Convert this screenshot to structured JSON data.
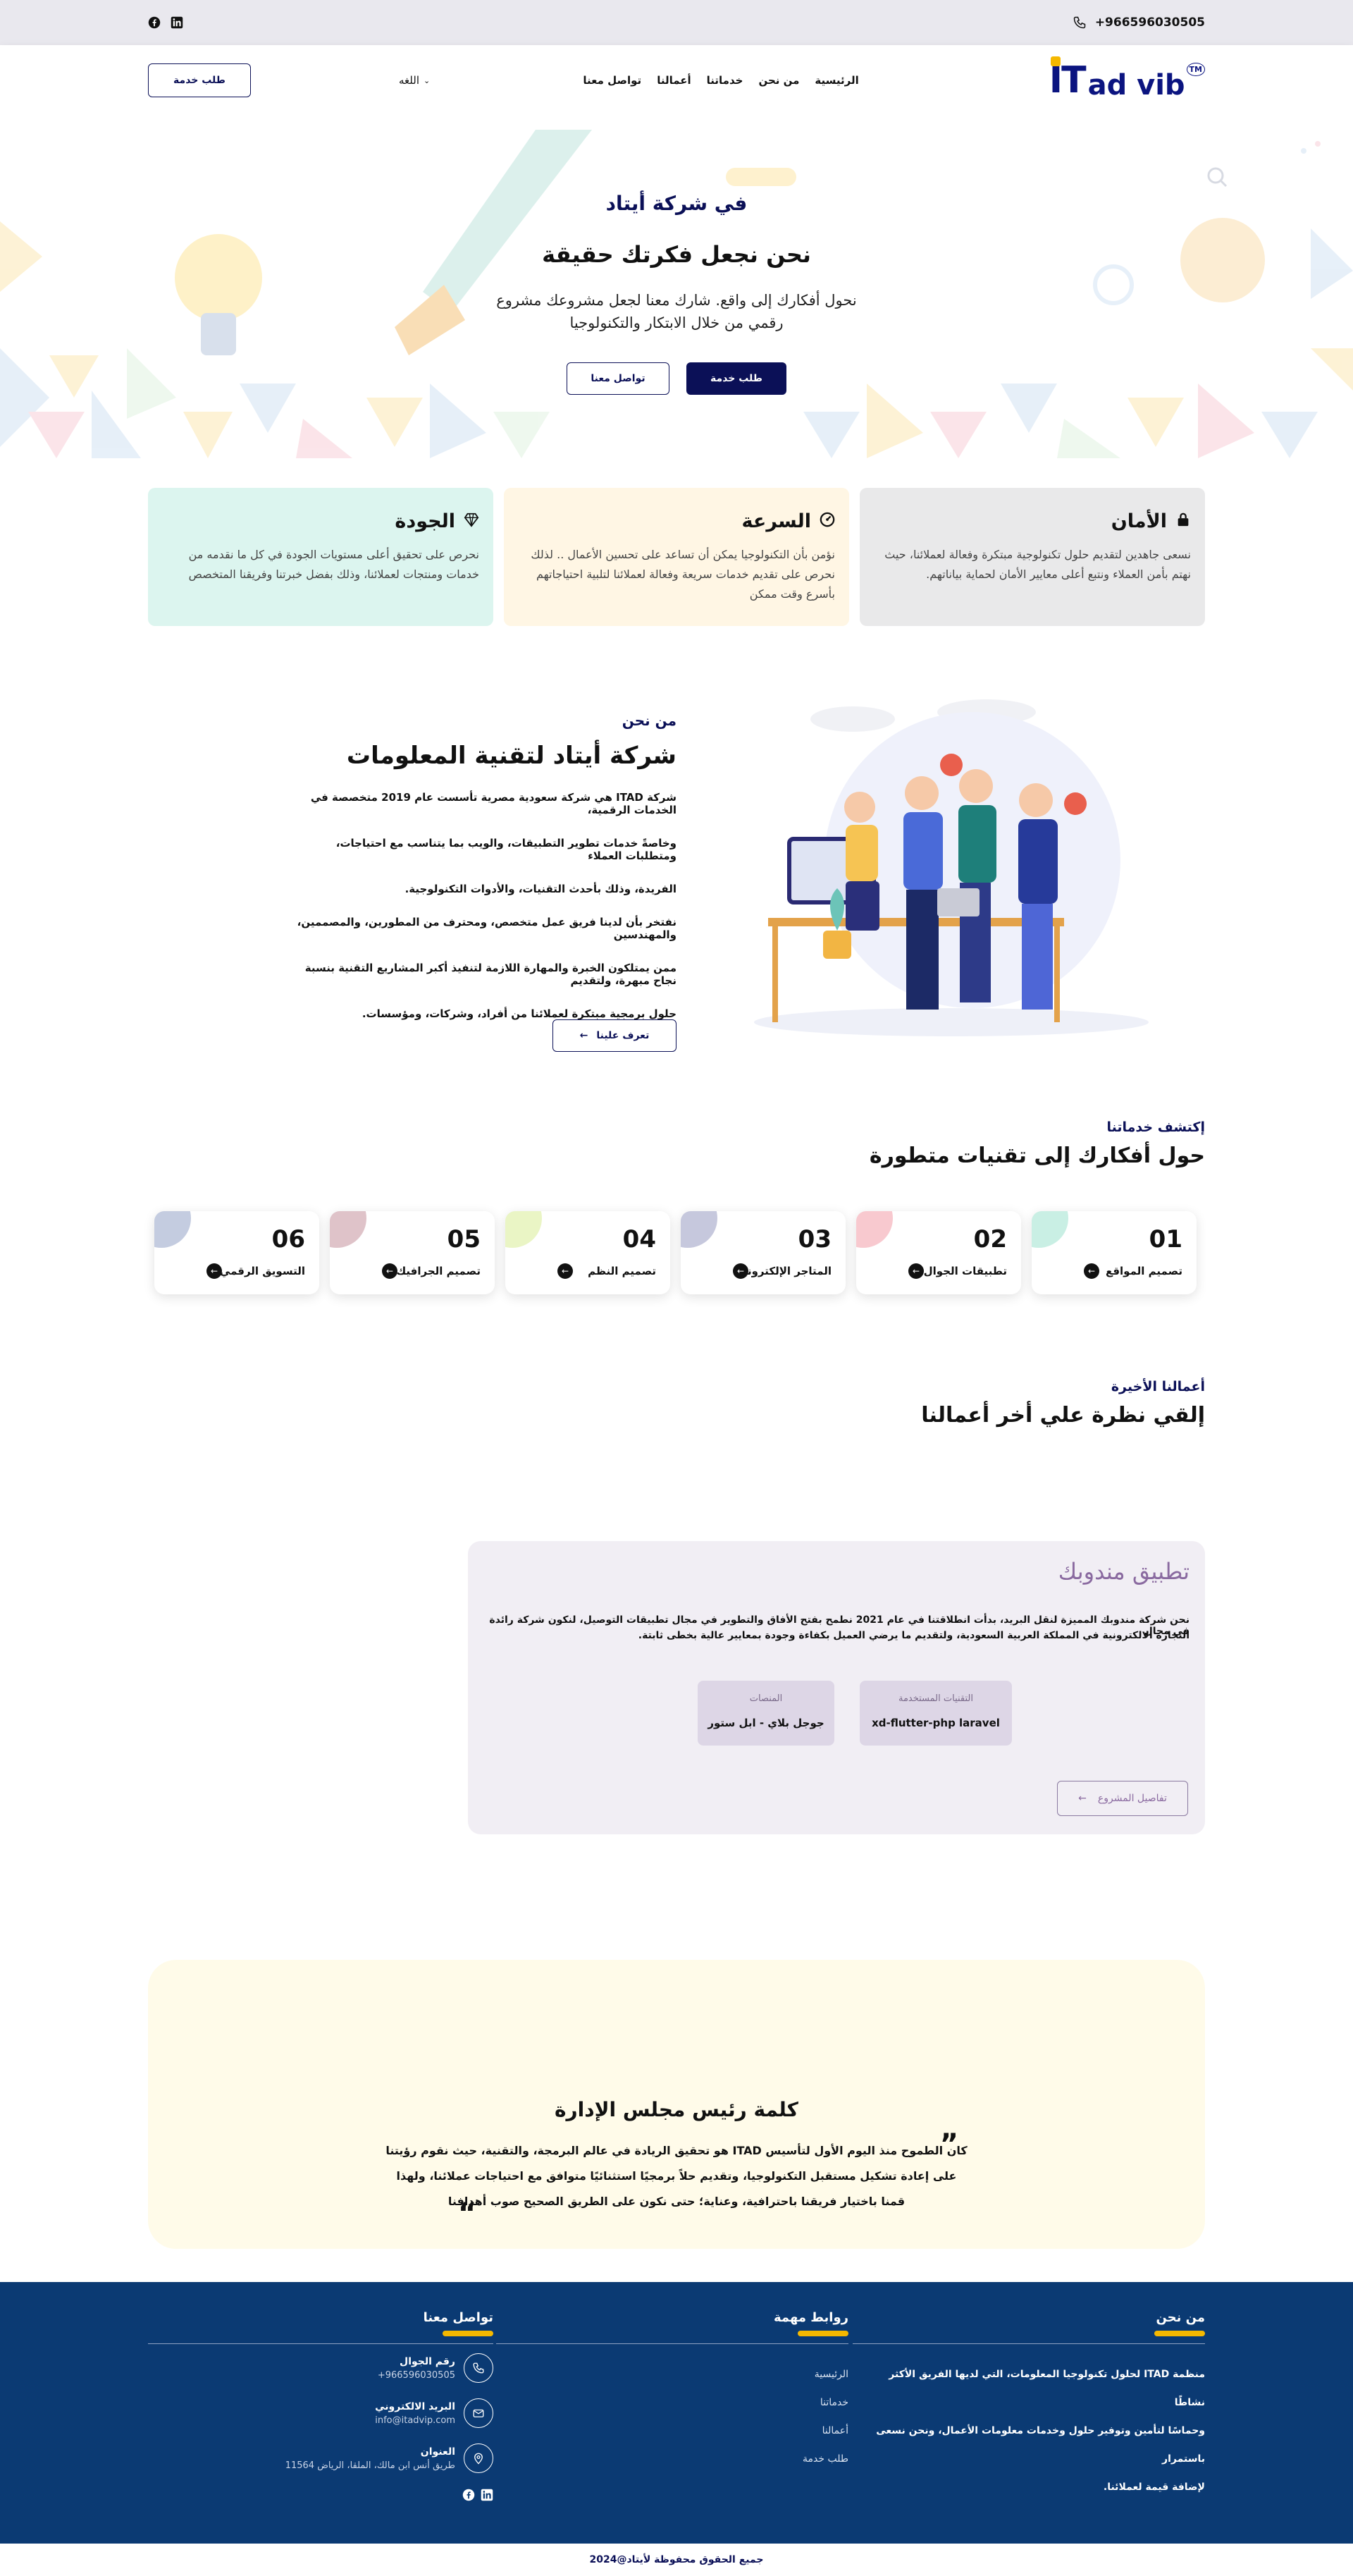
{
  "topbar": {
    "phone": "+966596030505",
    "social": [
      "facebook-icon",
      "linkedin-icon"
    ]
  },
  "nav": {
    "logo": {
      "it": "IT",
      "rest": "ad vib",
      "tm": "TM"
    },
    "menu": [
      "الرئيسية",
      "من نحن",
      "خدماتنا",
      "أعمالنا",
      "تواصل معنا"
    ],
    "language": "اللغه",
    "request_button": "طلب خدمة"
  },
  "hero": {
    "eyebrow": "في شركة أيتاد",
    "title": "نحن نجعل فكرتك حقيقة",
    "line1": "نحول أفكارك إلى واقع. شارك معنا لجعل مشروعك مشروع",
    "line2": "رقمي من خلال الابتكار والتكنولوجيا",
    "primary_button": "طلب خدمة",
    "secondary_button": "تواصل معنا"
  },
  "features": [
    {
      "title": "الأمان",
      "icon": "lock-icon",
      "text": [
        "نسعى جاهدين لتقديم حلول تكنولوجية مبتكرة وفعالة لعملائنا، حيث",
        "نهتم بأمن العملاء ونتبع أعلى معايير الأمان لحماية بياناتهم."
      ],
      "bg": "#e9e9ea"
    },
    {
      "title": "السرعة",
      "icon": "speed-icon",
      "text": [
        "نؤمن بأن التكنولوجيا يمكن أن تساعد على تحسين الأعمال .. لذلك",
        "نحرص على تقديم خدمات سريعة وفعالة لعملائنا لتلبية احتياجاتهم",
        "بأسرع وقت ممكن"
      ],
      "bg": "#fff6e4"
    },
    {
      "title": "الجودة",
      "icon": "diamond-icon",
      "text": [
        "نحرص على تحقيق أعلى مستويات الجودة في كل ما نقدمه من",
        "خدمات ومنتجات لعملائنا، وذلك بفضل خبرتنا وفريقنا المتخصص"
      ],
      "bg": "#dcf5ef"
    }
  ],
  "about": {
    "eyebrow": "من نحن",
    "title": "شركة أيتاد لتقنية المعلومات",
    "lines": [
      "شركة ITAD هي شركة سعودية مصرية تأسست عام 2019 متخصصة في الخدمات الرقمية،",
      "وخاصةً خدمات تطوير التطبيقات، والويب بما يتناسب مع احتياجات، ومتطلبات العملاء",
      "الفريدة، وذلك بأحدث التقنيات، والأدوات التكنولوجية.",
      "نفتخر بأن لدينا فريق عمل متخصص، ومحترف من المطورين، والمصممين، والمهندسين",
      "ممن يمتلكون الخبرة والمهارة اللازمة لتنفيذ أكبر المشاريع التقنية بنسبة نجاح مبهرة، ولتقديم",
      "حلول برمجية مبتكرة لعملائنا من أفراد، وشركات، ومؤسسات."
    ],
    "button": "تعرف علينا"
  },
  "services": {
    "eyebrow": "إكتشف خدماتنا",
    "title": "حول أفكارك إلى تقنيات متطورة",
    "items": [
      {
        "num": "01",
        "label": "تصميم المواقع",
        "color": "#c9efe4"
      },
      {
        "num": "02",
        "label": "تطبيقات الجوال",
        "color": "#f8c9cf"
      },
      {
        "num": "03",
        "label": "المتاجر الإلكترونية",
        "color": "#c6c8dd"
      },
      {
        "num": "04",
        "label": "تصميم النظم",
        "color": "#eaf5c5"
      },
      {
        "num": "05",
        "label": "تصميم الجرافيك",
        "color": "#dfc3c9"
      },
      {
        "num": "06",
        "label": "التسويق الرقمي",
        "color": "#c4cce0"
      }
    ]
  },
  "works": {
    "eyebrow": "أعمالنا الأخيرة",
    "title": "إلقي نظرة علي أخر أعمالنا",
    "project": {
      "title": "تطبيق مندوبك",
      "desc1": "نحن شركة مندوبك المميزة لنقل البريد، بدأت انطلاقتنا في عام 2021 نطمح بفتح الأفاق والتطوير في مجال تطبيقات التوصيل، لنكون شركة رائدة في مجال",
      "desc2": "التجارة الالكترونية في المملكة العربية السعودية، ولتقديم ما يرضي العميل بكفاءة وجودة بمعايير عالية بخطى ثابتة.",
      "tech_label": "التقنيات المستخدمة",
      "tech_value": "xd-flutter-php laravel",
      "platform_label": "المنصات",
      "platform_value": "جوجل بلاي - ابل ستور",
      "button": "تفاصيل المشروع"
    }
  },
  "chairman": {
    "title": "كلمة رئيس مجلس الإدارة",
    "lines": [
      "كان الطموح منذ اليوم الأول لتأسيس ITAD هو تحقيق الريادة في عالم البرمجة، والتقنية، حيث نقوم رؤيتنا",
      "على إعادة تشكيل مستقبل التكنولوجيا، وتقديم حلاً برمجيًا استثنائيًا متوافق مع احتياجات عملائنا، ولهذا",
      "قمنا باختيار فريقنا باحترافية، وعناية؛ حتى نكون على الطريق الصحيح صوب أهدافنا"
    ]
  },
  "footer": {
    "about_title": "من نحن",
    "about_lines": [
      "منظمة ITAD لحلول تكنولوجيا المعلومات، التي لديها الفريق الأكثر نشاطًا",
      "وحماسًا لتأمين وتوفير حلول وخدمات معلومات الأعمال، ونحن نسعى باستمرار",
      "لإضافة قيمة لعملائنا."
    ],
    "links_title": "روابط مهمة",
    "links": [
      "الرئيسية",
      "خدماتنا",
      "أعمالنا",
      "طلب خدمة"
    ],
    "contact_title": "تواصل معنا",
    "phone_label": "رقم الجوال",
    "phone": "+966596030505",
    "email_label": "البريد الالكتروني",
    "email": "info@itadvip.com",
    "address_label": "العنوان",
    "address": "طريق أنس ابن مالك، الملقا، الرياض 11564",
    "copyright": "جميع الحقوق محفوظة لأيتاد@2024"
  }
}
